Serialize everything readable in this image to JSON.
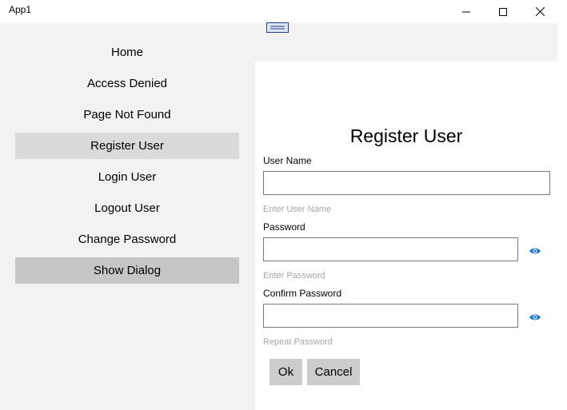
{
  "window": {
    "title": "App1",
    "controls": [
      "minimize-icon",
      "maximize-icon",
      "close-icon"
    ]
  },
  "nav": {
    "items": [
      {
        "label": "Home"
      },
      {
        "label": "Access Denied"
      },
      {
        "label": "Page Not Found"
      },
      {
        "label": "Register User",
        "state": "selected"
      },
      {
        "label": "Login User"
      },
      {
        "label": "Logout User"
      },
      {
        "label": "Change Password"
      },
      {
        "label": "Show Dialog",
        "state": "pressed"
      }
    ],
    "menu_icon": "hamburger-icon"
  },
  "form": {
    "title": "Register User",
    "username": {
      "label": "User Name",
      "value": "",
      "hint": "Enter User Name"
    },
    "password": {
      "label": "Password",
      "value": "",
      "hint": "Enter Password",
      "reveal_icon": "eye-icon"
    },
    "confirm": {
      "label": "Confirm Password",
      "value": "",
      "hint": "Repeat Password",
      "reveal_icon": "eye-icon"
    },
    "ok_label": "Ok",
    "cancel_label": "Cancel"
  },
  "colors": {
    "nav_background": "#f2f2f2",
    "selected_item": "#dadada",
    "pressed_item": "#c6c6c6",
    "accent": "#0078d7",
    "hint_text": "#a6a6a6",
    "button": "#cccccc"
  }
}
